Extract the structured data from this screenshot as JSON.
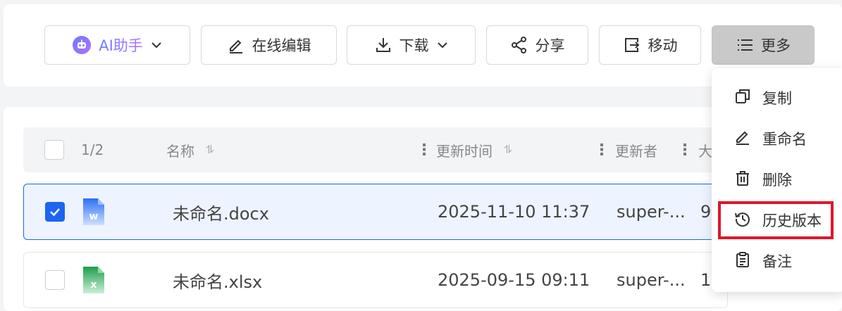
{
  "toolbar": {
    "ai_label": "AI助手",
    "edit_label": "在线编辑",
    "download_label": "下载",
    "share_label": "分享",
    "move_label": "移动",
    "more_label": "更多"
  },
  "table": {
    "selection_count": "1/2",
    "columns": {
      "name": "名称",
      "updated_time": "更新时间",
      "updater": "更新者",
      "size_partial": "大"
    },
    "sort_glyph": "⥮",
    "rows": [
      {
        "name": "未命名.docx",
        "time": "2025-11-10 11:37",
        "updater": "super-...",
        "size_partial": "9",
        "selected": true,
        "file_icon": "word-file-icon"
      },
      {
        "name": "未命名.xlsx",
        "time": "2025-09-15 09:11",
        "updater": "super-...",
        "size_partial": "1",
        "selected": false,
        "file_icon": "excel-file-icon"
      }
    ]
  },
  "more_menu": {
    "items": [
      {
        "label": "复制",
        "icon": "copy-icon"
      },
      {
        "label": "重命名",
        "icon": "pencil-icon"
      },
      {
        "label": "删除",
        "icon": "trash-icon"
      },
      {
        "label": "历史版本",
        "icon": "history-icon",
        "highlighted": true
      },
      {
        "label": "备注",
        "icon": "clipboard-icon"
      }
    ]
  },
  "colors": {
    "accent": "#1c64f2",
    "highlight": "#e0162b",
    "word_blue": "#2b6ff5",
    "excel_green": "#1f9e4a"
  }
}
